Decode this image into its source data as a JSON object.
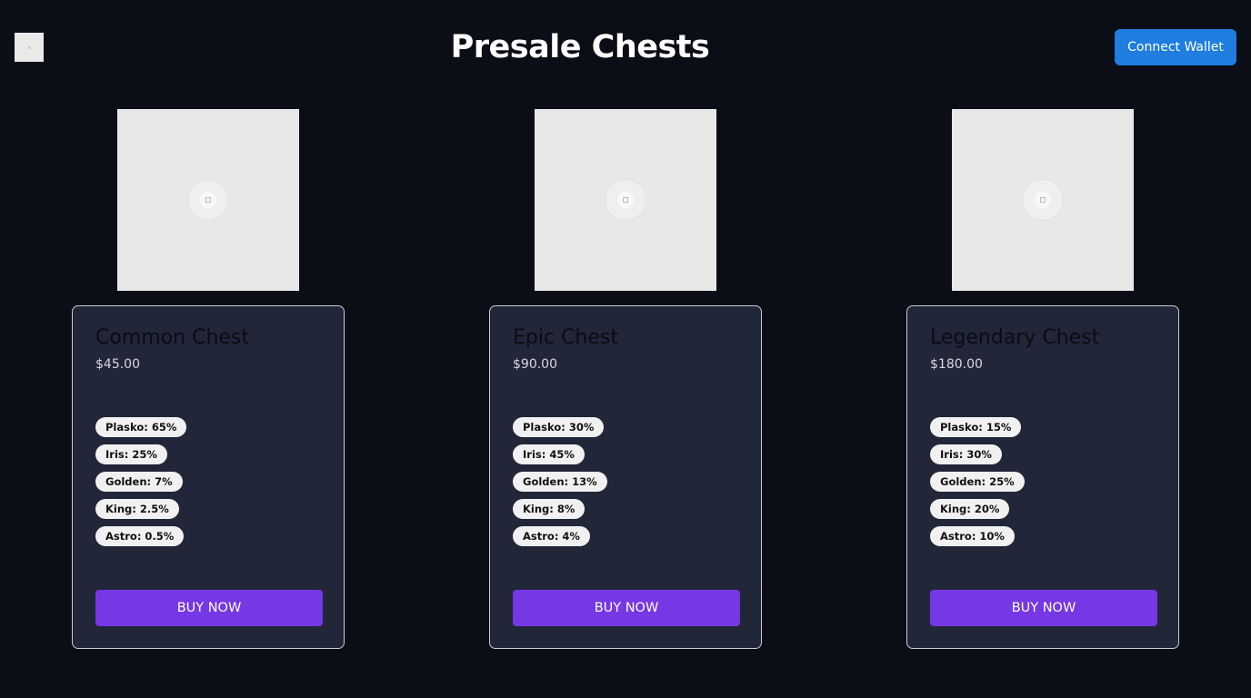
{
  "header": {
    "title": "Presale Chests",
    "connect_wallet_label": "Connect Wallet",
    "menu_icon": "menu-icon"
  },
  "colors": {
    "background": "#0b0e16",
    "card": "#212639",
    "connect_button": "#1f7ee0",
    "buy_button": "#7637e4"
  },
  "chests": [
    {
      "name": "Common Chest",
      "price": "$45.00",
      "image_icon": "broken-image-icon",
      "odds": [
        "Plasko: 65%",
        "Iris: 25%",
        "Golden: 7%",
        "King: 2.5%",
        "Astro: 0.5%"
      ],
      "buy_label": "BUY NOW"
    },
    {
      "name": "Epic Chest",
      "price": "$90.00",
      "image_icon": "broken-image-icon",
      "odds": [
        "Plasko: 30%",
        "Iris: 45%",
        "Golden: 13%",
        "King: 8%",
        "Astro: 4%"
      ],
      "buy_label": "BUY NOW"
    },
    {
      "name": "Legendary Chest",
      "price": "$180.00",
      "image_icon": "broken-image-icon",
      "odds": [
        "Plasko: 15%",
        "Iris: 30%",
        "Golden: 25%",
        "King: 20%",
        "Astro: 10%"
      ],
      "buy_label": "BUY NOW"
    }
  ]
}
